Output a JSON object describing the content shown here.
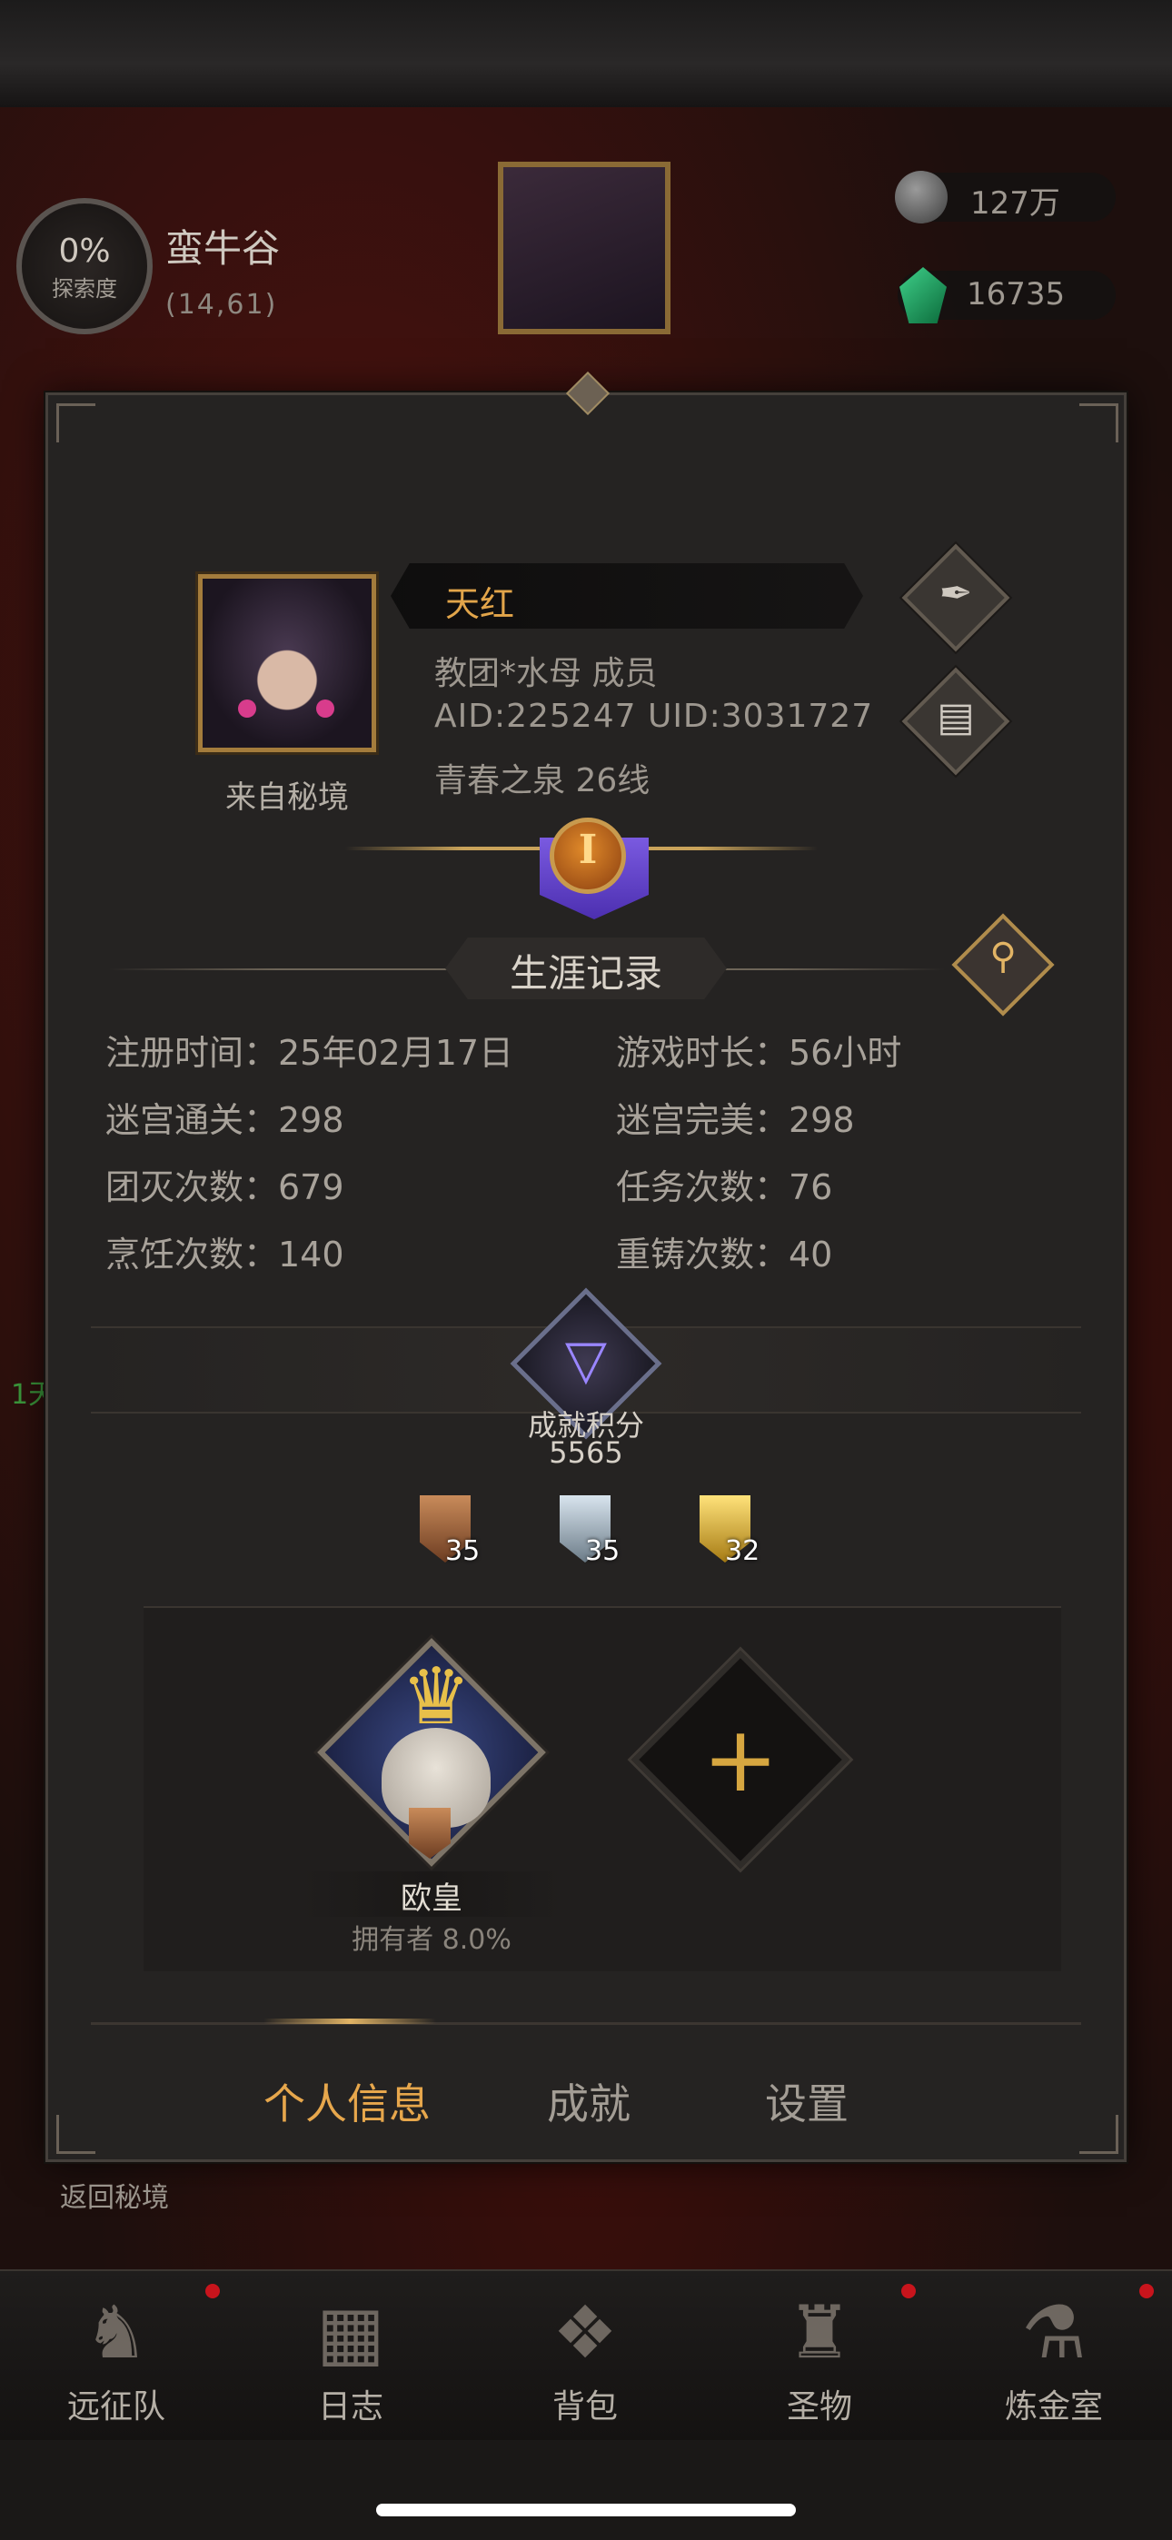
{
  "hud": {
    "explore_percent": "0%",
    "explore_label": "探索度",
    "location_name": "蛮牛谷",
    "location_coords": "(14,61)",
    "currency_1": "127万",
    "currency_2": "16735",
    "side_text": "1天"
  },
  "profile": {
    "name": "天红",
    "guild": "教团*水母  成员",
    "ids": "AID:225247 UID:3031727",
    "server": "青春之泉  26线",
    "origin": "来自秘境",
    "rank": "I"
  },
  "career": {
    "title": "生涯记录",
    "stats": [
      "注册时间：25年02月17日",
      "游戏时长：56小时",
      "迷宫通关：298",
      "迷宫完美：298",
      "团灭次数：679",
      "任务次数：76",
      "烹饪次数：140",
      "重铸次数：40"
    ]
  },
  "achievement": {
    "label": "成就积分",
    "value": "5565",
    "badges": {
      "bronze": "35",
      "silver": "35",
      "gold": "32"
    }
  },
  "showcase": {
    "title_name": "欧皇",
    "owners": "拥有者 8.0%"
  },
  "tabs": {
    "info": "个人信息",
    "achievement": "成就",
    "settings": "设置"
  },
  "return_label": "返回秘境",
  "nav": [
    "远征队",
    "日志",
    "背包",
    "圣物",
    "炼金室"
  ],
  "colors": {
    "accent_gold": "#e7a74c",
    "panel_bg": "#252322",
    "rank_purple": "#6a4ad0",
    "alert_red": "#c8141c"
  },
  "icons": {
    "edit": "quill-icon",
    "copy": "scroll-icon",
    "search": "magnifier-icon",
    "add": "plus-icon"
  }
}
